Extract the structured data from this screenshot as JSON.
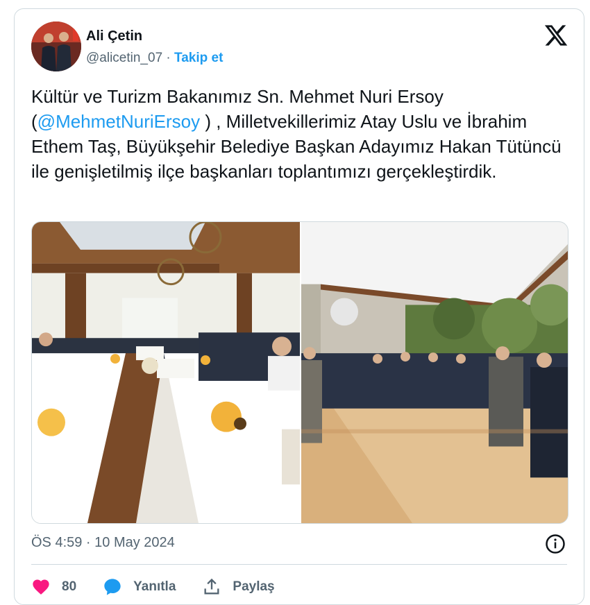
{
  "author": {
    "name": "Ali Çetin",
    "handle": "@alicetin_07",
    "separator": "·",
    "follow_label": "Takip et"
  },
  "icons": {
    "brand": "x-logo-icon",
    "info": "info-icon",
    "like": "heart-icon",
    "reply": "speech-bubble-icon",
    "share": "share-upload-icon"
  },
  "tweet": {
    "text_part1": "Kültür ve Turizm Bakanımız Sn. Mehmet Nuri Ersoy (",
    "mention": "@MehmetNuriErsoy",
    "text_part2": " ) , Milletvekillerimiz Atay Uslu ve İbrahim Ethem Taş, Büyükşehir Belediye Başkan Adayımız Hakan Tütüncü ile genişletilmiş ilçe başkanları toplantımızı gerçekleştirdik."
  },
  "meta": {
    "timestamp": "ÖS 4:59 · 10 May 2024"
  },
  "actions": {
    "like_count": "80",
    "reply_label": "Yanıtla",
    "share_label": "Paylaş"
  },
  "colors": {
    "accent": "#1d9bf0",
    "like": "#f91880",
    "text": "#0f1419",
    "muted": "#536471",
    "border": "#cfd9de"
  }
}
